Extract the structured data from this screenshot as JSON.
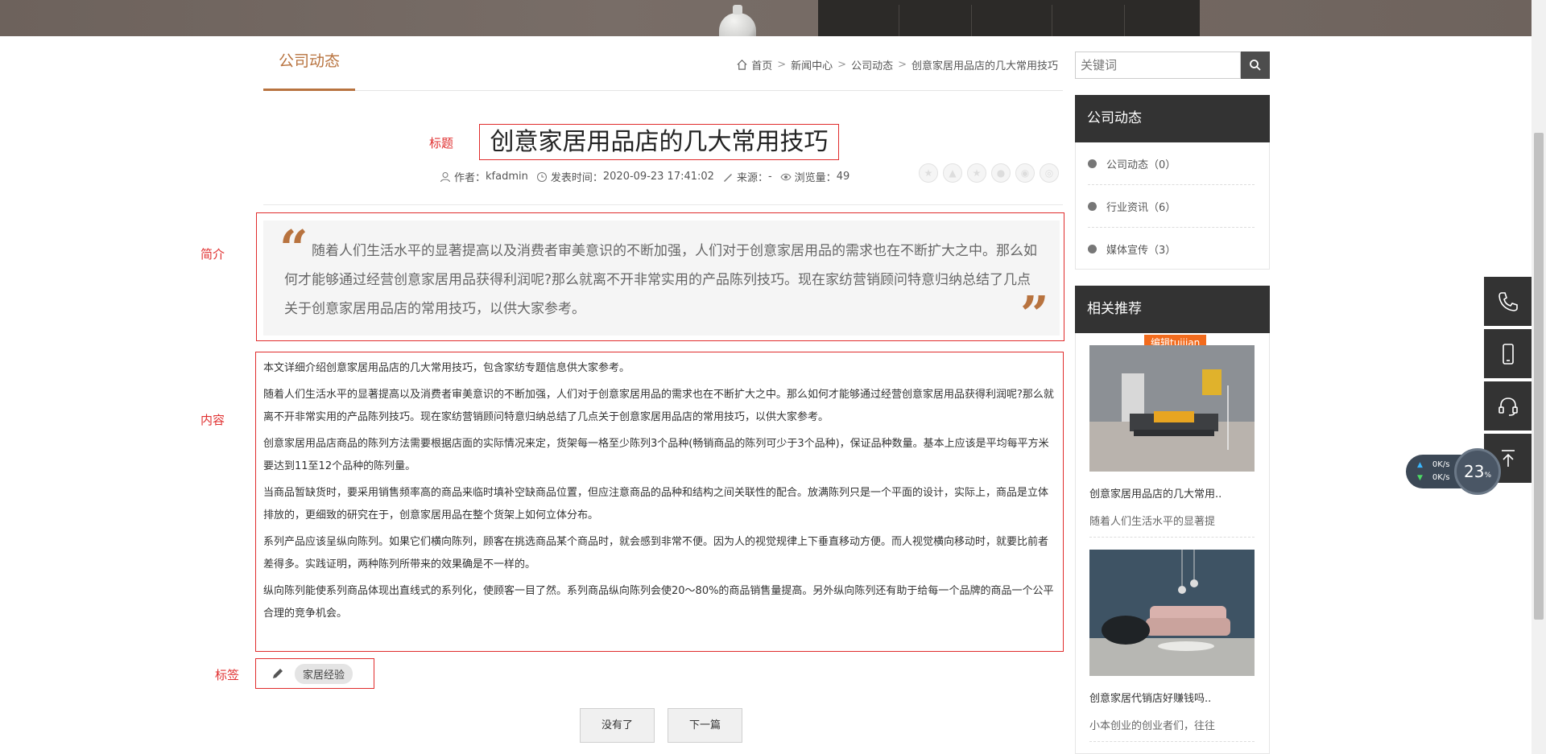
{
  "tab": {
    "label": "公司动态"
  },
  "breadcrumb": [
    {
      "label": "首页"
    },
    {
      "label": "新闻中心"
    },
    {
      "label": "公司动态"
    },
    {
      "label": "创意家居用品店的几大常用技巧"
    }
  ],
  "annotations": {
    "title": "标题",
    "summary": "简介",
    "content": "内容",
    "tags": "标签"
  },
  "article": {
    "title": "创意家居用品店的几大常用技巧",
    "meta": {
      "author_label": "作者：",
      "author": "kfadmin",
      "time_label": "发表时间：",
      "time": "2020-09-23 17:41:02",
      "source_label": "来源：",
      "source": "-",
      "views_label": "浏览量：",
      "views": "49"
    },
    "summary": "随着人们生活水平的显著提高以及消费者审美意识的不断加强，人们对于创意家居用品的需求也在不断扩大之中。那么如何才能够通过经营创意家居用品获得利润呢?那么就离不开非常实用的产品陈列技巧。现在家纺营销顾问特意归纳总结了几点关于创意家居用品店的常用技巧，以供大家参考。",
    "paragraphs": [
      "本文详细介绍创意家居用品店的几大常用技巧，包含家纺专题信息供大家参考。",
      "随着人们生活水平的显著提高以及消费者审美意识的不断加强，人们对于创意家居用品的需求也在不断扩大之中。那么如何才能够通过经营创意家居用品获得利润呢?那么就离不开非常实用的产品陈列技巧。现在家纺营销顾问特意归纳总结了几点关于创意家居用品店的常用技巧，以供大家参考。",
      "创意家居用品店商品的陈列方法需要根据店面的实际情况来定，货架每一格至少陈列3个品种(畅销商品的陈列可少于3个品种)，保证品种数量。基本上应该是平均每平方米要达到11至12个品种的陈列量。",
      "当商品暂缺货时，要采用销售频率高的商品来临时填补空缺商品位置，但应注意商品的品种和结构之间关联性的配合。放满陈列只是一个平面的设计，实际上，商品是立体排放的，更细致的研究在于，创意家居用品在整个货架上如何立体分布。",
      "系列产品应该呈纵向陈列。如果它们横向陈列，顾客在挑选商品某个商品时，就会感到非常不便。因为人的视觉规律上下垂直移动方便。而人视觉横向移动时，就要比前者差得多。实践证明，两种陈列所带来的效果确是不一样的。",
      "纵向陈列能使系列商品体现出直线式的系列化，使顾客一目了然。系列商品纵向陈列会使20～80%的商品销售量提高。另外纵向陈列还有助于给每一个品牌的商品一个公平合理的竞争机会。"
    ],
    "tag": "家居经验"
  },
  "pager": {
    "prev": "没有了",
    "next": "下一篇"
  },
  "search": {
    "placeholder": "关键词"
  },
  "sidebar": {
    "category_title": "公司动态",
    "categories": [
      {
        "label": "公司动态（0）"
      },
      {
        "label": "行业资讯（6）"
      },
      {
        "label": "媒体宣传（3）"
      }
    ],
    "recommend_title": "相关推荐",
    "badge": "编辑tuijian",
    "recommend": [
      {
        "title": "创意家居用品店的几大常用..",
        "desc": "随着人们生活水平的显著提"
      },
      {
        "title": "创意家居代销店好赚钱吗..",
        "desc": "小本创业的创业者们，往往"
      }
    ]
  },
  "speed_widget": {
    "up": "0K/s",
    "down": "0K/s",
    "cpu": "23",
    "cpu_unit": "%"
  },
  "colors": {
    "accent": "#b8733f",
    "dark": "#333333",
    "annotation": "#e03030",
    "badge": "#f26b1d"
  },
  "icons": [
    "home-icon",
    "user-icon",
    "clock-icon",
    "pen-icon",
    "eye-icon",
    "search-icon",
    "phone-icon",
    "mobile-icon",
    "headset-icon",
    "back-to-top-icon"
  ]
}
